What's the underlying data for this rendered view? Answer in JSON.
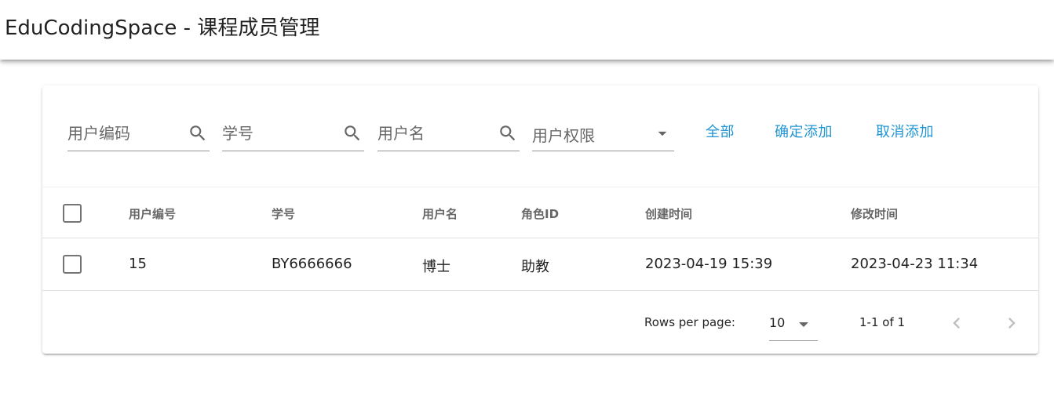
{
  "app": {
    "title": "EduCodingSpace - 课程成员管理"
  },
  "filters": {
    "user_code": {
      "placeholder": "用户编码",
      "icon": "search-icon"
    },
    "student_id": {
      "placeholder": "学号",
      "icon": "search-icon"
    },
    "username": {
      "placeholder": "用户名",
      "icon": "search-icon"
    },
    "role_select": {
      "label": "用户权限",
      "icon": "menu-down-icon"
    }
  },
  "actions": {
    "all_label": "全部",
    "confirm_add_label": "确定添加",
    "cancel_add_label": "取消添加",
    "accent_color": "#2196d3"
  },
  "table": {
    "headers": [
      "用户编号",
      "学号",
      "用户名",
      "角色ID",
      "创建时间",
      "修改时间"
    ],
    "rows": [
      {
        "user_id": "15",
        "student_id": "BY6666666",
        "username": "博士",
        "role": "助教",
        "created": "2023-04-19 15:39",
        "modified": "2023-04-23 11:34",
        "selected": false
      }
    ]
  },
  "pagination": {
    "rows_per_page_label": "Rows per page:",
    "rows_per_page_value": "10",
    "range_text": "1-1 of 1",
    "prev_icon": "chevron-left-icon",
    "next_icon": "chevron-right-icon"
  }
}
